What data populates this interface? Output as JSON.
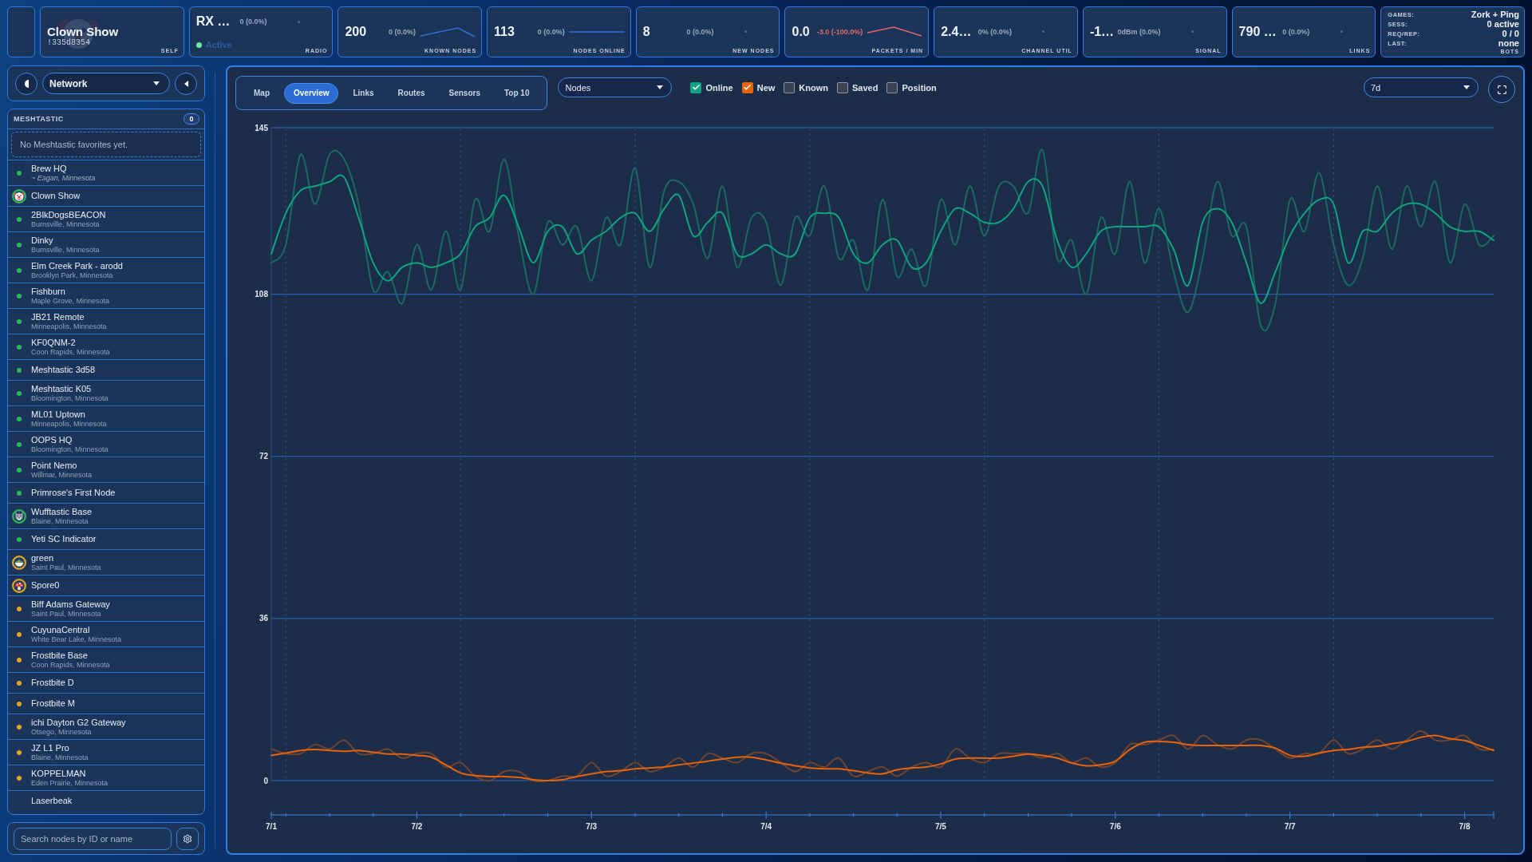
{
  "top_bar": {
    "cards": [
      {
        "kind": "self",
        "title": "Clown Show",
        "node_id": "!335d8354",
        "avatar": {
          "kind": "clown"
        },
        "label": "SELF"
      },
      {
        "kind": "radio",
        "value": "RX …",
        "delta": "0 (0.0%)",
        "negative": false,
        "sparkline": {
          "kind": "dot"
        },
        "active": true,
        "status": "Active",
        "label": "RADIO"
      },
      {
        "kind": "stat",
        "value": "200",
        "delta": "0 (0.0%)",
        "negative": false,
        "sparkline": {
          "kind": "peak"
        },
        "label": "KNOWN NODES"
      },
      {
        "kind": "stat",
        "value": "113",
        "delta": "0 (0.0%)",
        "negative": false,
        "sparkline": {
          "kind": "flat"
        },
        "label": "NODES ONLINE"
      },
      {
        "kind": "stat",
        "value": "8",
        "delta": "0 (0.0%)",
        "negative": false,
        "sparkline": {
          "kind": "dot"
        },
        "label": "NEW NODES"
      },
      {
        "kind": "stat",
        "value": "0.0",
        "delta": "-3.0 (-100.0%)",
        "negative": true,
        "sparkline": {
          "kind": "peak"
        },
        "label": "PACKETS / MIN"
      },
      {
        "kind": "stat",
        "value": "2.4…",
        "delta": "0% (0.0%)",
        "negative": false,
        "sparkline": {
          "kind": "dot"
        },
        "label": "CHANNEL UTIL"
      },
      {
        "kind": "stat",
        "value": "-1…",
        "delta": "0dBm (0.0%)",
        "negative": false,
        "sparkline": {
          "kind": "dot"
        },
        "label": "SIGNAL"
      },
      {
        "kind": "stat",
        "value": "790 …",
        "delta": "0 (0.0%)",
        "negative": false,
        "sparkline": {
          "kind": "dot"
        },
        "label": "LINKS"
      },
      {
        "kind": "bots",
        "rows": [
          {
            "key": "GAMES:",
            "value": "Zork + Ping"
          },
          {
            "key": "SESS:",
            "value": "0 active"
          },
          {
            "key": "REQ/REP:",
            "value": "0 / 0"
          },
          {
            "key": "LAST:",
            "value": "none"
          }
        ],
        "label": "BOTS"
      }
    ]
  },
  "sidebar": {
    "view_select": {
      "value": "Network"
    },
    "favorites": {
      "title": "MESHTASTIC",
      "count": "0",
      "empty_message": "No Meshtastic favorites yet.",
      "nodes": [
        {
          "name": "Brew HQ",
          "location": "~ Eagan, Minnesota",
          "estimated": true,
          "kind": "dot",
          "color": "#2eb85c"
        },
        {
          "name": "Clown Show",
          "kind": "clown",
          "color": "#2eb85c"
        },
        {
          "name": "2BlkDogsBEACON",
          "location": "Burnsville, Minnesota",
          "estimated": false,
          "kind": "dot",
          "color": "#2eb85c"
        },
        {
          "name": "Dinky",
          "location": "Burnsville, Minnesota",
          "estimated": false,
          "kind": "dot",
          "color": "#2eb85c"
        },
        {
          "name": "Elm Creek Park - arodd",
          "location": "Brooklyn Park, Minnesota",
          "estimated": false,
          "kind": "dot",
          "color": "#2eb85c"
        },
        {
          "name": "Fishburn",
          "location": "Maple Grove, Minnesota",
          "estimated": false,
          "kind": "dot",
          "color": "#2eb85c"
        },
        {
          "name": "JB21 Remote",
          "location": "Minneapolis, Minnesota",
          "estimated": false,
          "kind": "dot",
          "color": "#2eb85c"
        },
        {
          "name": "KF0QNM-2",
          "location": "Coon Rapids, Minnesota",
          "estimated": false,
          "kind": "dot",
          "color": "#2eb85c"
        },
        {
          "name": "Meshtastic 3d58",
          "kind": "dot",
          "color": "#2eb85c"
        },
        {
          "name": "Meshtastic K05",
          "location": "Bloomington, Minnesota",
          "estimated": false,
          "kind": "dot",
          "color": "#2eb85c"
        },
        {
          "name": "ML01 Uptown",
          "location": "Minneapolis, Minnesota",
          "estimated": false,
          "kind": "dot",
          "color": "#2eb85c"
        },
        {
          "name": "OOPS HQ",
          "location": "Bloomington, Minnesota",
          "estimated": false,
          "kind": "dot",
          "color": "#2eb85c"
        },
        {
          "name": "Point Nemo",
          "location": "Willmar, Minnesota",
          "estimated": false,
          "kind": "dot",
          "color": "#2eb85c"
        },
        {
          "name": "Primrose's First Node",
          "kind": "dot",
          "color": "#2eb85c"
        },
        {
          "name": "Wufftastic Base",
          "location": "Blaine, Minnesota",
          "estimated": false,
          "kind": "wolf",
          "color": "#2eb85c"
        },
        {
          "name": "Yeti SC Indicator",
          "kind": "dot",
          "color": "#2eb85c"
        },
        {
          "name": "green",
          "location": "Saint Paul, Minnesota",
          "estimated": false,
          "kind": "salad",
          "color": "#e2a623"
        },
        {
          "name": "Spore0",
          "kind": "mushroom",
          "color": "#e2a623"
        },
        {
          "name": "Biff Adams Gateway",
          "location": "Saint Paul, Minnesota",
          "estimated": false,
          "kind": "dot",
          "color": "#e2a623"
        },
        {
          "name": "CuyunaCentral",
          "location": "White Bear Lake, Minnesota",
          "estimated": false,
          "kind": "dot",
          "color": "#e2a623"
        },
        {
          "name": "Frostbite Base",
          "location": "Coon Rapids, Minnesota",
          "estimated": false,
          "kind": "dot",
          "color": "#e2a623"
        },
        {
          "name": "Frostbite D",
          "kind": "dot",
          "color": "#e2a623"
        },
        {
          "name": "Frostbite M",
          "kind": "dot",
          "color": "#e2a623"
        },
        {
          "name": "ichi Dayton G2 Gateway",
          "location": "Otsego, Minnesota",
          "estimated": false,
          "kind": "dot",
          "color": "#e2a623"
        },
        {
          "name": "JZ L1 Pro",
          "location": "Blaine, Minnesota",
          "estimated": false,
          "kind": "dot",
          "color": "#e2a623"
        },
        {
          "name": "KOPPELMAN",
          "location": "Eden Prairie, Minnesota",
          "estimated": false,
          "kind": "dot",
          "color": "#e2a623"
        },
        {
          "name": "Laserbeak"
        }
      ]
    },
    "search": {
      "placeholder": "Search nodes by ID or name"
    }
  },
  "main": {
    "tabs": [
      {
        "label": "Map",
        "selected": false
      },
      {
        "label": "Overview",
        "selected": true
      },
      {
        "label": "Links",
        "selected": false
      },
      {
        "label": "Routes",
        "selected": false
      },
      {
        "label": "Sensors",
        "selected": false
      },
      {
        "label": "Top 10",
        "selected": false
      }
    ],
    "metric_select": {
      "value": "Nodes"
    },
    "filters": [
      {
        "label": "Online",
        "checked": true,
        "color": "#0fa37f"
      },
      {
        "label": "New",
        "checked": true,
        "color": "#e8630a"
      },
      {
        "label": "Known",
        "checked": false
      },
      {
        "label": "Saved",
        "checked": false
      },
      {
        "label": "Position",
        "checked": false
      }
    ],
    "range_select": {
      "value": "7d"
    },
    "chart_data": {
      "type": "line",
      "grid": true,
      "categories": [
        "7/1",
        null,
        null,
        null,
        null,
        null,
        null,
        null,
        null,
        null,
        "7/2",
        null,
        null,
        null,
        null,
        null,
        null,
        null,
        null,
        null,
        null,
        null,
        "7/3",
        null,
        null,
        null,
        null,
        null,
        null,
        null,
        null,
        null,
        null,
        null,
        "7/4",
        null,
        null,
        null,
        null,
        null,
        null,
        null,
        null,
        null,
        null,
        null,
        "7/5",
        null,
        null,
        null,
        null,
        null,
        null,
        null,
        null,
        null,
        null,
        null,
        "7/6",
        null,
        null,
        null,
        null,
        null,
        null,
        null,
        null,
        null,
        null,
        null,
        "7/7",
        null,
        null,
        null,
        null,
        null,
        null,
        null,
        null,
        null,
        null,
        null,
        "7/8",
        null,
        null
      ],
      "series": [
        {
          "color": "#1b6a62",
          "values": [
            115,
            119,
            139,
            128,
            139,
            138,
            128,
            109,
            113,
            106,
            119,
            109,
            122,
            109,
            129,
            122,
            138,
            121,
            108,
            124,
            119,
            123,
            111,
            125,
            119,
            136,
            114,
            131,
            133,
            128,
            116,
            132,
            114,
            125,
            124,
            110,
            125,
            121,
            132,
            116,
            120,
            109,
            129,
            112,
            118,
            110,
            129,
            119,
            132,
            121,
            132,
            132,
            126,
            140,
            116,
            120,
            108,
            125,
            117,
            133,
            115,
            127,
            113,
            104,
            116,
            133,
            121,
            123,
            101,
            106,
            129,
            122,
            135,
            119,
            110,
            116,
            132,
            118,
            132,
            123,
            133,
            115,
            128,
            119,
            121
          ]
        },
        {
          "color": "#72442f",
          "values": [
            7,
            6,
            6,
            8,
            7,
            9,
            6,
            6,
            7,
            5,
            6,
            6,
            3,
            4,
            1,
            0,
            2,
            2,
            0,
            0,
            1,
            1,
            4,
            1,
            2,
            4,
            2,
            3,
            5,
            3,
            6,
            5,
            4,
            6,
            6,
            4,
            2,
            4,
            3,
            5,
            1,
            2,
            3,
            1,
            3,
            4,
            3,
            7,
            5,
            4,
            6,
            6,
            6,
            5,
            6,
            4,
            5,
            3,
            4,
            8,
            8,
            9,
            10,
            7,
            10,
            8,
            7,
            9,
            9,
            7,
            5,
            6,
            6,
            9,
            6,
            7,
            9,
            7,
            9,
            11,
            9,
            9,
            10,
            7,
            7
          ]
        },
        {
          "color": "#0fa37f",
          "values": [
            117,
            126,
            131,
            132,
            133,
            134,
            125,
            115,
            111,
            114,
            115,
            114,
            115,
            117,
            123,
            125,
            130,
            123,
            115,
            122,
            123,
            117,
            120,
            122,
            125,
            126,
            122,
            127,
            130,
            121,
            124,
            126,
            117,
            117,
            119,
            117,
            117,
            125,
            126,
            125,
            117,
            115,
            119,
            120,
            114,
            115,
            122,
            127,
            126,
            124,
            124,
            127,
            133,
            132,
            120,
            114,
            117,
            122,
            123,
            123,
            123,
            123,
            118,
            110,
            124,
            127,
            124,
            115,
            106,
            113,
            121,
            126,
            129,
            128,
            115,
            122,
            122,
            126,
            128,
            128,
            126,
            123,
            122,
            122,
            120
          ]
        },
        {
          "color": "#e8630a",
          "values": [
            5.6,
            6.1,
            6.7,
            6.9,
            6.7,
            6.5,
            6.7,
            6.3,
            5.9,
            5.9,
            5.6,
            5.2,
            3.5,
            1.7,
            1.1,
            0.9,
            0.9,
            0.7,
            0.2,
            0,
            0.2,
            0.9,
            1.5,
            2,
            2.2,
            2.6,
            2.8,
            3,
            3.5,
            3.9,
            4.3,
            4.8,
            5.2,
            5.2,
            4.6,
            3.9,
            3.3,
            2.8,
            2.6,
            2.6,
            2.2,
            1.7,
            1.5,
            2.4,
            2.8,
            3,
            3.7,
            4.8,
            5,
            5,
            5,
            5.4,
            5.9,
            5.6,
            5,
            3.9,
            3.3,
            3.5,
            4.3,
            6.9,
            8.5,
            8.7,
            8.5,
            8,
            7.8,
            7.8,
            7.8,
            7.8,
            7.8,
            7.2,
            5.6,
            5.4,
            6.1,
            6.7,
            6.9,
            7.4,
            7.6,
            8.2,
            8.7,
            9.6,
            10,
            9.3,
            8.9,
            7.8,
            6.7
          ]
        }
      ],
      "ylim": [
        0,
        145
      ],
      "yticks": [
        0,
        36,
        72,
        108,
        145
      ]
    }
  }
}
